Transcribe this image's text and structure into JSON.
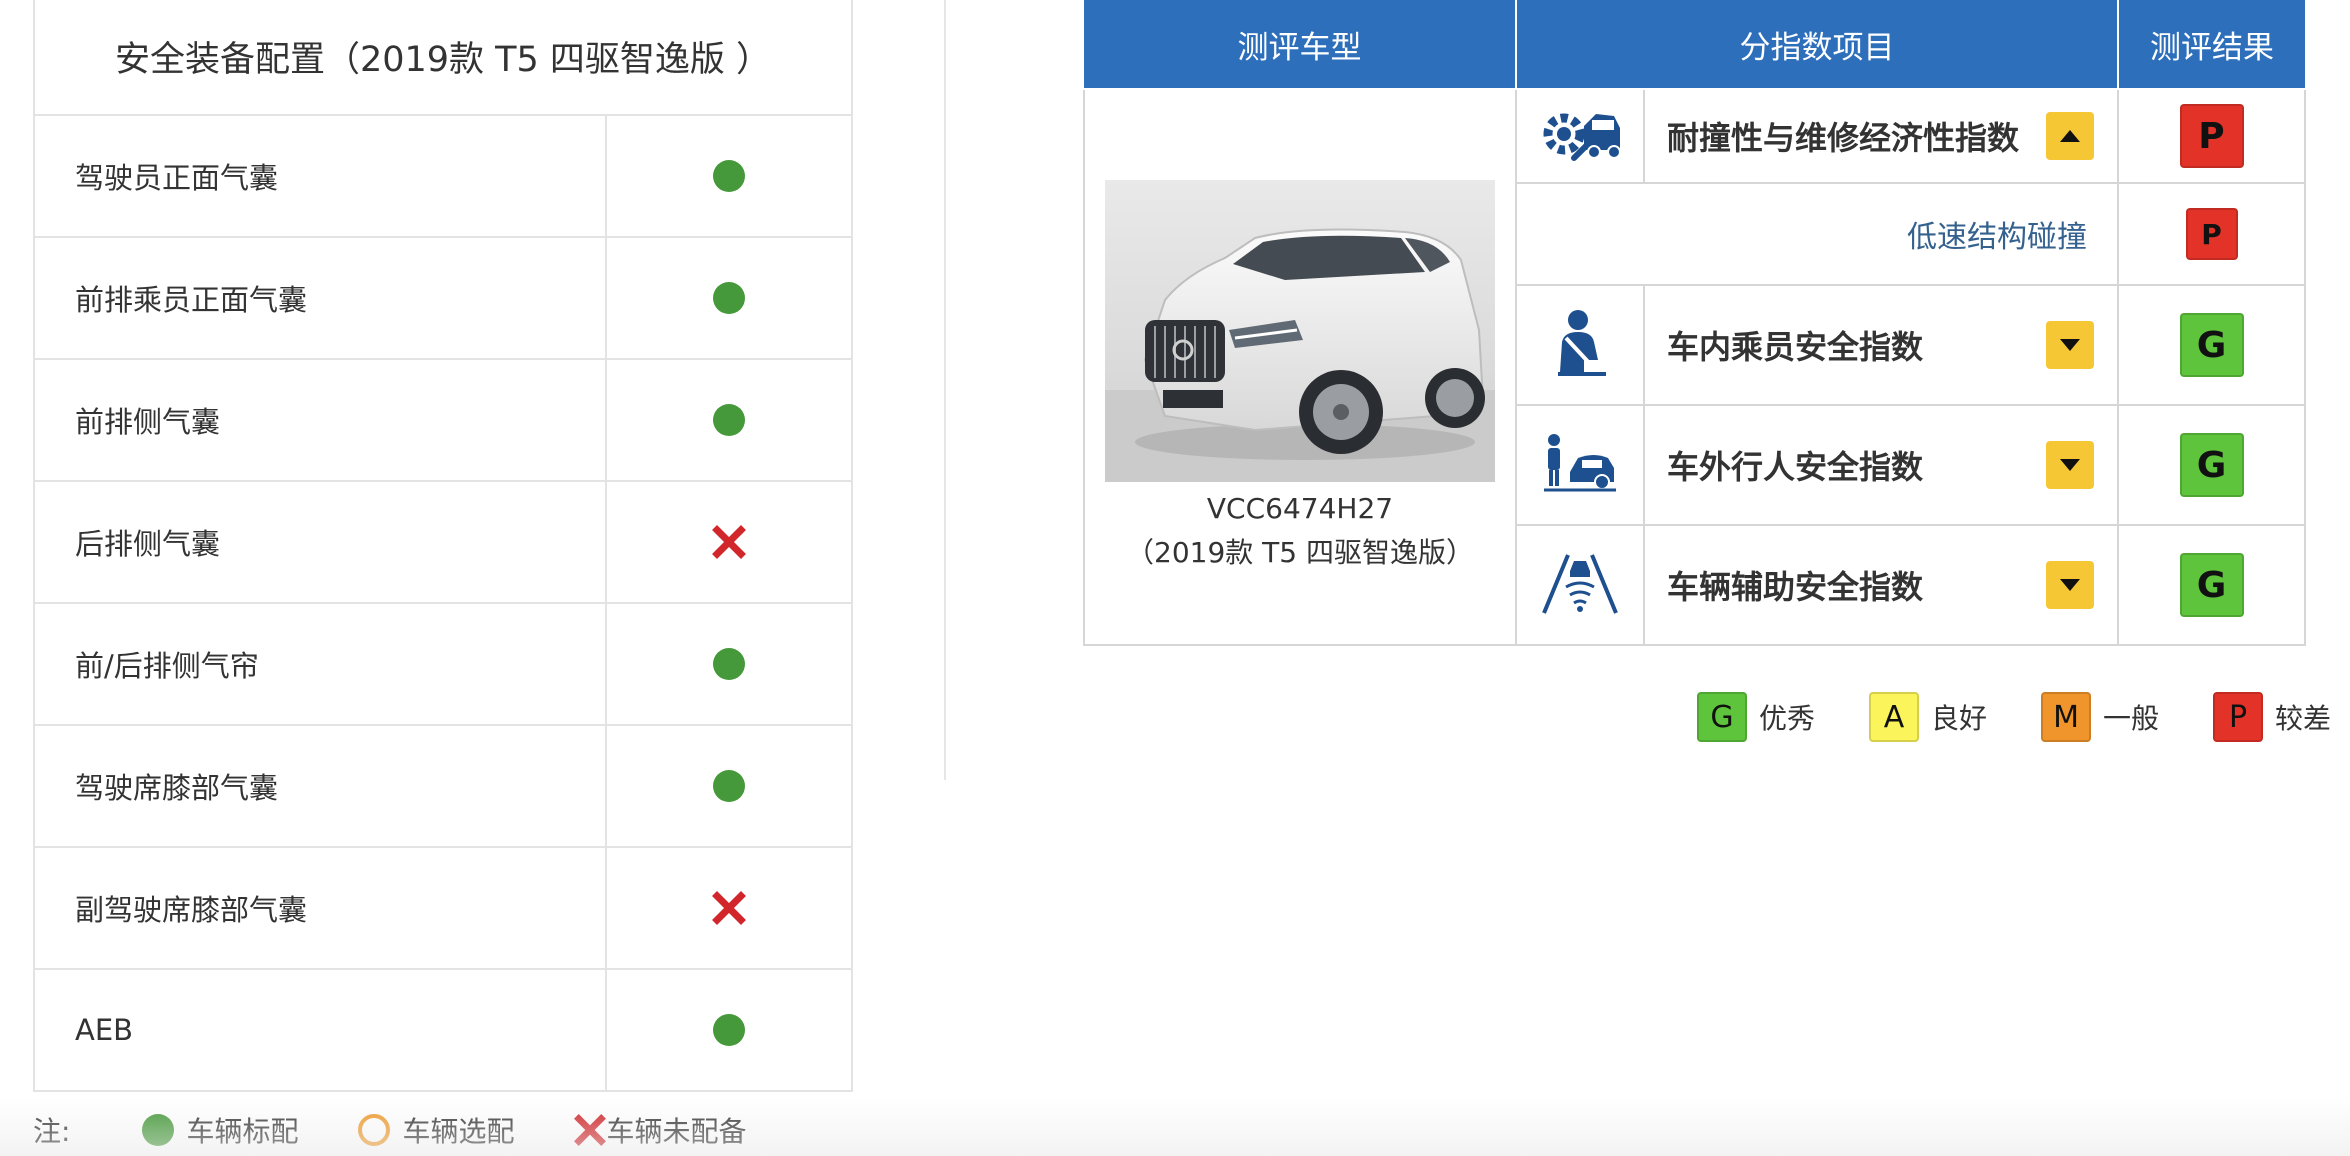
{
  "equipment": {
    "title": "安全装备配置（2019款 T5 四驱智逸版 ）",
    "items": [
      {
        "label": "驾驶员正面气囊",
        "status": "standard"
      },
      {
        "label": "前排乘员正面气囊",
        "status": "standard"
      },
      {
        "label": "前排侧气囊",
        "status": "standard"
      },
      {
        "label": "后排侧气囊",
        "status": "none"
      },
      {
        "label": "前/后排侧气帘",
        "status": "standard"
      },
      {
        "label": "驾驶席膝部气囊",
        "status": "standard"
      },
      {
        "label": "副驾驶席膝部气囊",
        "status": "none"
      },
      {
        "label": "AEB",
        "status": "standard"
      }
    ],
    "legend": {
      "note": "注:",
      "standard": "车辆标配",
      "optional": "车辆选配",
      "none": "车辆未配备"
    }
  },
  "results": {
    "headers": {
      "model": "测评车型",
      "index": "分指数项目",
      "result": "测评结果"
    },
    "vehicle": {
      "model": "VCC6474H27",
      "version": "（2019款 T5 四驱智逸版）"
    },
    "rows": [
      {
        "icon": "repair-icon",
        "name": "耐撞性与维修经济性指数",
        "arrow": "up",
        "grade": "P"
      },
      {
        "sub": true,
        "name": "低速结构碰撞",
        "grade": "P"
      },
      {
        "icon": "occupant-seatbelt-icon",
        "name": "车内乘员安全指数",
        "arrow": "down",
        "grade": "G"
      },
      {
        "icon": "pedestrian-car-icon",
        "name": "车外行人安全指数",
        "arrow": "down",
        "grade": "G"
      },
      {
        "icon": "driver-assist-icon",
        "name": "车辆辅助安全指数",
        "arrow": "down",
        "grade": "G"
      }
    ],
    "legend": [
      {
        "grade": "G",
        "label": "优秀"
      },
      {
        "grade": "A",
        "label": "良好"
      },
      {
        "grade": "M",
        "label": "一般"
      },
      {
        "grade": "P",
        "label": "较差"
      }
    ]
  },
  "colors": {
    "header_blue": "#2d6fbb",
    "grade_G": "#5ec43c",
    "grade_A": "#fbf45a",
    "grade_M": "#f0952b",
    "grade_P": "#e33328",
    "standard_dot": "#45993a",
    "optional_ring": "#f09a2c",
    "none_cross": "#d1262a",
    "arrow_box": "#f5c735"
  }
}
